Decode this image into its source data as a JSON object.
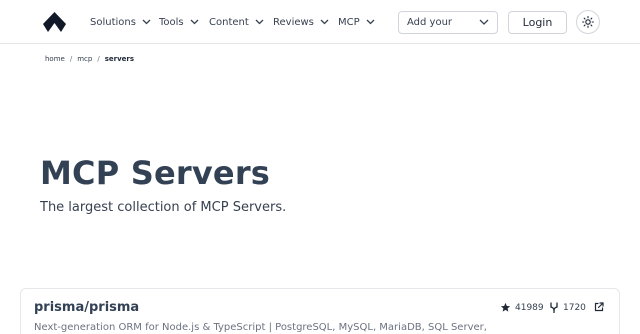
{
  "nav": {
    "items": [
      {
        "label": "Solutions"
      },
      {
        "label": "Tools"
      },
      {
        "label": "Content"
      },
      {
        "label": "Reviews"
      },
      {
        "label": "MCP"
      }
    ],
    "select_value": "Add your",
    "login_label": "Login"
  },
  "breadcrumb": {
    "items": [
      "home",
      "mcp",
      "servers"
    ]
  },
  "hero": {
    "title": "MCP Servers",
    "subtitle": "The largest collection of MCP Servers."
  },
  "server": {
    "name": "prisma/prisma",
    "stars": "41989",
    "forks": "1720",
    "description": "Next-generation ORM for Node.js & TypeScript | PostgreSQL, MySQL, MariaDB, SQL Server,"
  },
  "icons": {
    "logo": "logo-icon",
    "theme": "sun-icon",
    "star": "star-icon",
    "fork": "fork-icon",
    "external": "external-link-icon"
  },
  "colors": {
    "heading": "#334155",
    "border": "#e5e7eb"
  }
}
